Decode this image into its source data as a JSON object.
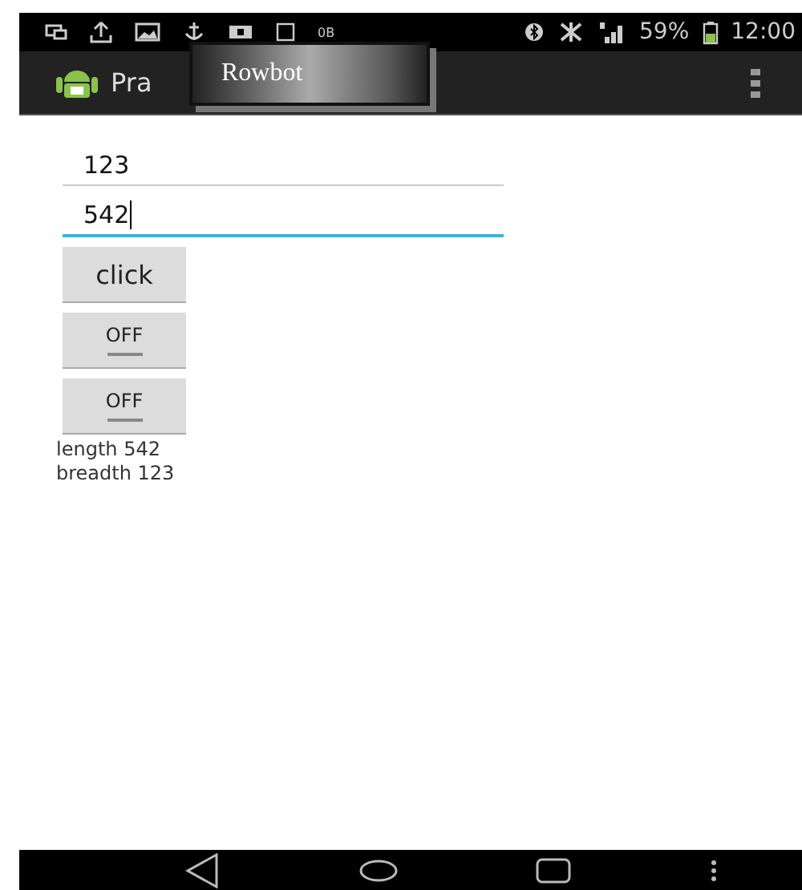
{
  "status_bar": {
    "data_rate": "0B",
    "battery": "59%",
    "time": "12:00"
  },
  "action_bar": {
    "title": "Pra"
  },
  "toast": {
    "text": "Rowbot"
  },
  "fields": [
    {
      "value": "123",
      "focused": false
    },
    {
      "value": "542",
      "focused": true
    }
  ],
  "button": {
    "label": "click"
  },
  "toggles": [
    {
      "label": "OFF",
      "checked": false
    },
    {
      "label": "OFF",
      "checked": false
    }
  ],
  "results": [
    "length  542",
    "breadth  123"
  ]
}
